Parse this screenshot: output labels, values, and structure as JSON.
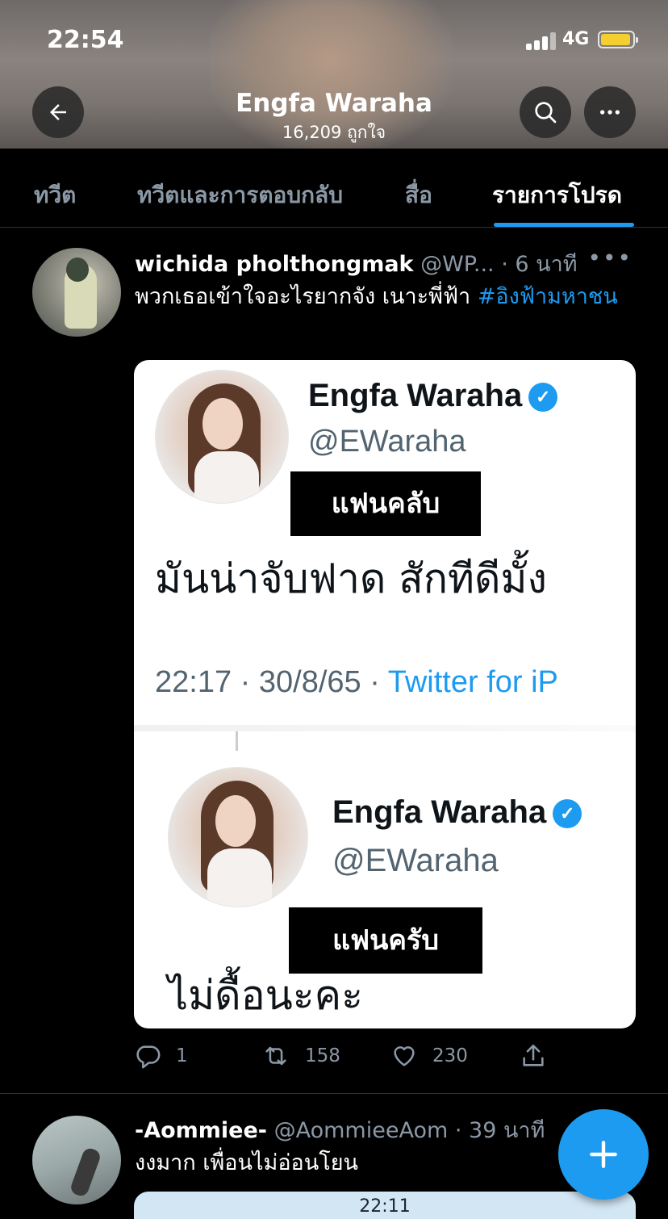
{
  "status_bar": {
    "time": "22:54",
    "network": "4G"
  },
  "header": {
    "title": "Engfa Waraha",
    "subtitle": "16,209 ถูกใจ"
  },
  "tabs": [
    {
      "label": "ทวีต"
    },
    {
      "label": "ทวีตและการตอบกลับ"
    },
    {
      "label": "สื่อ"
    },
    {
      "label": "รายการโปรด",
      "active": true
    }
  ],
  "tweets": [
    {
      "name": "wichida pholthongmak",
      "handle": "@WP...",
      "time": "· 6 นาที",
      "text": "พวกเธอเข้าใจอะไรยากจัง เนาะพี่ฟ้า ",
      "hashtag": "#อิงฟ้ามหาชน",
      "media": {
        "top_card": {
          "name": "Engfa Waraha",
          "handle": "@EWaraha",
          "label": "แฟนคลับ",
          "text": "มันน่าจับฟาด สักทีดีมั้ง",
          "timestamp": "22:17 · 30/8/65 · ",
          "source": "Twitter for iP"
        },
        "bottom_card": {
          "name": "Engfa Waraha",
          "handle": "@EWaraha",
          "label": "แฟนครับ",
          "text": "ไม่ดื้อนะคะ"
        }
      },
      "stats": {
        "replies": "1",
        "retweets": "158",
        "likes": "230"
      }
    },
    {
      "name": "-Aommiee-",
      "handle": "@AommieeAom",
      "time": "· 39 นาที",
      "text": "งงมาก เพื่อนไม่อ่อนโยน",
      "media_preview": "22:11"
    }
  ],
  "icons": {
    "back": "arrow-left-icon",
    "search": "search-icon",
    "more": "more-horizontal-icon",
    "reply": "reply-icon",
    "retweet": "retweet-icon",
    "like": "heart-icon",
    "share": "share-icon",
    "compose": "plus-icon",
    "verified": "verified-badge-icon"
  },
  "colors": {
    "accent": "#1d9bf0",
    "background": "#000000",
    "muted": "#8b98a5"
  }
}
